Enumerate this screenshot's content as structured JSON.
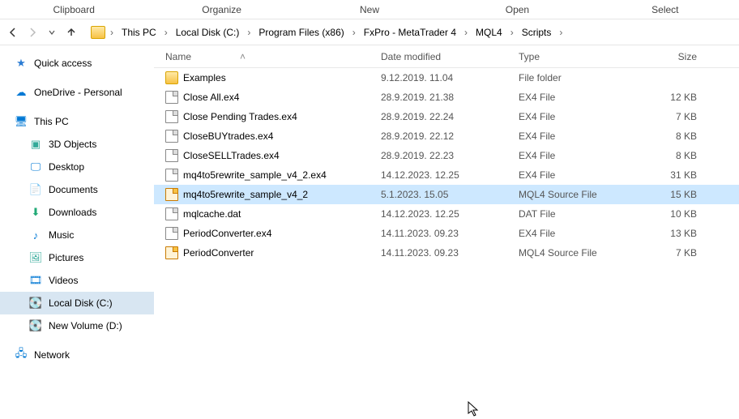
{
  "ribbon": {
    "clipboard": "Clipboard",
    "organize": "Organize",
    "new": "New",
    "open": "Open",
    "select": "Select"
  },
  "breadcrumb": {
    "items": [
      "This PC",
      "Local Disk (C:)",
      "Program Files (x86)",
      "FxPro - MetaTrader 4",
      "MQL4",
      "Scripts"
    ]
  },
  "sidebar": {
    "quick_access": "Quick access",
    "onedrive": "OneDrive - Personal",
    "this_pc": "This PC",
    "objects3d": "3D Objects",
    "desktop": "Desktop",
    "documents": "Documents",
    "downloads": "Downloads",
    "music": "Music",
    "pictures": "Pictures",
    "videos": "Videos",
    "local_disk": "Local Disk (C:)",
    "new_volume": "New Volume (D:)",
    "network": "Network"
  },
  "columns": {
    "name": "Name",
    "date": "Date modified",
    "type": "Type",
    "size": "Size"
  },
  "files": [
    {
      "icon": "folder",
      "name": "Examples",
      "date": "9.12.2019. 11.04",
      "type": "File folder",
      "size": ""
    },
    {
      "icon": "file",
      "name": "Close All.ex4",
      "date": "28.9.2019. 21.38",
      "type": "EX4 File",
      "size": "12 KB"
    },
    {
      "icon": "file",
      "name": "Close Pending Trades.ex4",
      "date": "28.9.2019. 22.24",
      "type": "EX4 File",
      "size": "7 KB"
    },
    {
      "icon": "file",
      "name": "CloseBUYtrades.ex4",
      "date": "28.9.2019. 22.12",
      "type": "EX4 File",
      "size": "8 KB"
    },
    {
      "icon": "file",
      "name": "CloseSELLTrades.ex4",
      "date": "28.9.2019. 22.23",
      "type": "EX4 File",
      "size": "8 KB"
    },
    {
      "icon": "file",
      "name": "mq4to5rewrite_sample_v4_2.ex4",
      "date": "14.12.2023. 12.25",
      "type": "EX4 File",
      "size": "31 KB"
    },
    {
      "icon": "mql",
      "name": "mq4to5rewrite_sample_v4_2",
      "date": "5.1.2023. 15.05",
      "type": "MQL4 Source File",
      "size": "15 KB",
      "selected": true
    },
    {
      "icon": "file",
      "name": "mqlcache.dat",
      "date": "14.12.2023. 12.25",
      "type": "DAT File",
      "size": "10 KB"
    },
    {
      "icon": "file",
      "name": "PeriodConverter.ex4",
      "date": "14.11.2023. 09.23",
      "type": "EX4 File",
      "size": "13 KB"
    },
    {
      "icon": "mql",
      "name": "PeriodConverter",
      "date": "14.11.2023. 09.23",
      "type": "MQL4 Source File",
      "size": "7 KB"
    }
  ]
}
